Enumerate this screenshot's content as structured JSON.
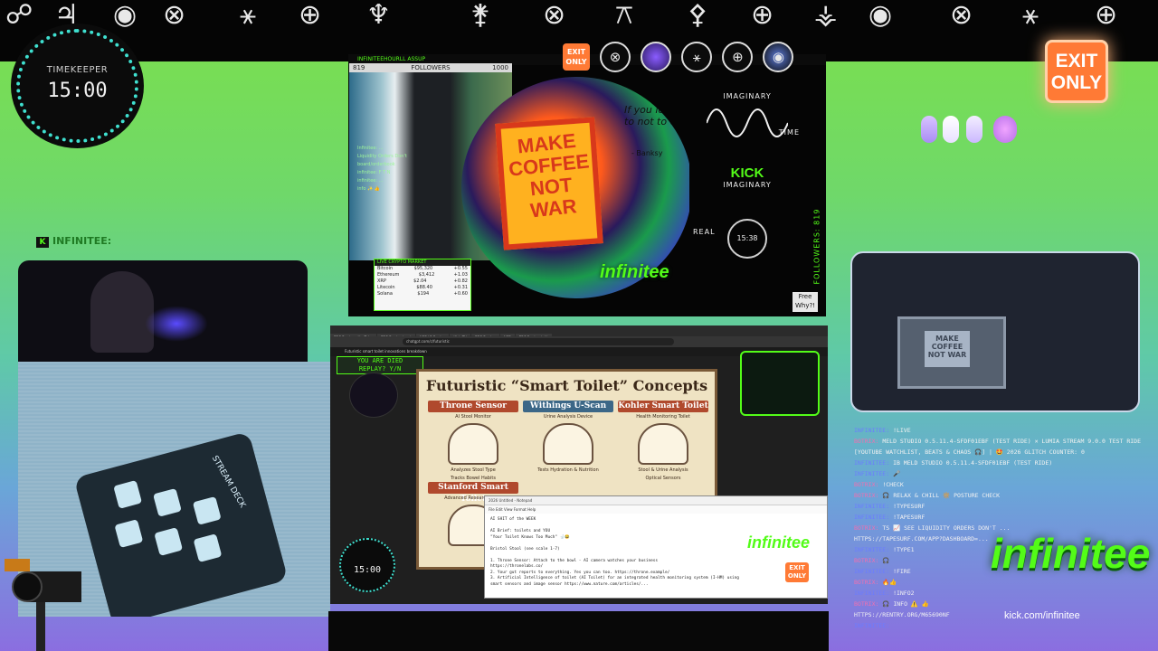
{
  "top_glyphs": [
    "☍",
    "♃",
    "◉",
    "⊗",
    "⚹",
    "⊕",
    "♆",
    "⚵",
    "⊗",
    "⚻",
    "⚴",
    "⊕",
    "⚶",
    "◉",
    "⊗",
    "⚹",
    "⊕"
  ],
  "timekeeper": {
    "label": "TIMEKEEPER",
    "time": "15:00"
  },
  "exit_sign": {
    "line1": "EXIT",
    "line2": "ONLY"
  },
  "nametag": {
    "platform": "K",
    "name": "INFINITEE:"
  },
  "center_top": {
    "header": "INFINITEEHOURLL ASSUP",
    "followers_label": "FOLLOWERS",
    "followers_count": "1000",
    "followers_current": "819",
    "exit_mini": {
      "line1": "EXIT",
      "line2": "ONLY"
    },
    "art_sign": "MAKE COFFEE NOT WAR",
    "art_quote": "If you learn to not to quit",
    "art_quote_author": "- Banksy",
    "wave_label_top": "IMAGINARY",
    "wave_label_time": "TIME",
    "kick_logo": "KICK",
    "wave_label_bottom": "IMAGINARY",
    "real_label": "REAL",
    "clock": "15:38",
    "vertical_followers": "FOLLOWERS: 819",
    "infinitee_logo": "infinitee",
    "free_why": "Free Why?!",
    "mini_chat": [
      "Infinitee: ...",
      "Liquidity Orders Don't",
      "board/orderbook",
      "infinitee: F T N",
      "infinitee: ...",
      "info ✨ 👍"
    ],
    "crypto": {
      "header": "LIVE CRYPTO MARKET",
      "rows": [
        {
          "name": "Bitcoin",
          "price": "$95,320",
          "chg": "+0.55"
        },
        {
          "name": "Ethereum",
          "price": "$3,412",
          "chg": "+1.03"
        },
        {
          "name": "XRP",
          "price": "$2.04",
          "chg": "+0.82"
        },
        {
          "name": "Litecoin",
          "price": "$88.40",
          "chg": "+0.31"
        },
        {
          "name": "Solana",
          "price": "$194",
          "chg": "+0.60"
        }
      ]
    }
  },
  "browser": {
    "tabs": [
      "ERC Replay - YouTube",
      "ERC Replay (sec)",
      "NSF LP Replay",
      "Kick.TV",
      "ERC Replay",
      "NSF",
      "ERC Replay (alt)"
    ],
    "address": "chatgpt.com/c/futuristic",
    "doc_title": "Futuristic smart toilet innovations breakdown",
    "died_line1": "YOU ARE DIED",
    "died_line2": "REPLAY? Y/N"
  },
  "concepts": {
    "title": "Futuristic “Smart Toilet” Concepts",
    "panels": [
      {
        "name": "Throne Sensor",
        "sub": "AI Stool Monitor",
        "features": [
          "Analyzes Stool Type",
          "Tracks Bowel Habits"
        ],
        "color": "#b0492d"
      },
      {
        "name": "Withings U-Scan",
        "sub": "Urine Analysis Device",
        "features": [
          "Tests Hydration & Nutrition"
        ],
        "color": "#3c6787"
      },
      {
        "name": "Kohler Smart Toilet",
        "sub": "Health Monitoring Toilet",
        "features": [
          "Stool & Urine Analysis",
          "Optical Sensors"
        ],
        "color": "#b0492d"
      },
      {
        "name": "Stanford Smart Toilet",
        "sub": "Advanced Research Proto",
        "features": [],
        "color": "#b0492d"
      }
    ]
  },
  "editor": {
    "tabbar": "2026 Untitled - Notepad",
    "menu": "File   Edit   View   Format   Help",
    "lines": [
      "AI SHIT of the WEEK",
      "",
      "AI Brief: toilets and YOU",
      "\"Your Toilet Knows Too Much\" 🚽😂",
      "",
      "Bristol Stool (see scale 1-7)",
      "",
      "1. Throne Sensor: Attach to the bowl - AI camera watches your business",
      "   https://thronelabs.co/",
      "2. Your gut reports to everything. Yes you can too. https://throne.example/",
      "3. Artificial Intelligence of toilet (AI Toilet) for an integrated health monitoring system (I-HM) using",
      "   smart sensors and image sensor https://www.nature.com/articles/..."
    ]
  },
  "tk_small": {
    "time": "15:00"
  },
  "infinitee_mid": "infinitee",
  "exit_mini2": {
    "line1": "EXIT",
    "line2": "ONLY"
  },
  "chat": [
    {
      "user": "INFINITEE:",
      "msg": "!LIVE"
    },
    {
      "user": "BOTRIX:",
      "msg": "MELD STUDIO 0.5.11.4-SFDF01EBF (TEST RIDE) ✕ LUMIA STREAM 9.0.0 TEST RIDE [YOUTUBE WATCHLIST, BEATS & CHAOS 🎧] | 🤩 2026 GLITCH COUNTER: 0"
    },
    {
      "user": "INFINITEE:",
      "msg": "IB MELD STUDIO 0.5.11.4-SFDF01EBF (TEST RIDE)"
    },
    {
      "user": "INFINITEE:",
      "msg": "🎤"
    },
    {
      "user": "BOTRIX:",
      "msg": "!CHECK"
    },
    {
      "user": "BOTRIX:",
      "msg": "🎧 RELAX & CHILL 🔆 POSTURE CHECK"
    },
    {
      "user": "INFINITEE:",
      "msg": "!TYPESURF"
    },
    {
      "user": "INFINITEE:",
      "msg": "!TAPESURF"
    },
    {
      "user": "BOTRIX:",
      "msg": "TS 📈 SEE LIQUIDITY ORDERS DON'T ..."
    },
    {
      "user": "",
      "msg": "HTTPS://TAPESURF.COM/APP?DASHBOARD=..."
    },
    {
      "user": "INFINITEE:",
      "msg": "!TYPE1"
    },
    {
      "user": "BOTRIX:",
      "msg": "🎧"
    },
    {
      "user": "INFINITEE:",
      "msg": "!FIRE"
    },
    {
      "user": "BOTRIX:",
      "msg": "🔥👍"
    },
    {
      "user": "INFINITEE:",
      "msg": "!INFO2"
    },
    {
      "user": "BOTRIX:",
      "msg": "🎧 INFO ⚠️ 👍"
    },
    {
      "user": "",
      "msg": "HTTPS://RENTRY.ORG/M65690NF"
    },
    {
      "user": "INFINITEE:",
      "msg": ""
    }
  ],
  "infinitee_big": "infinitee",
  "kick_url": "kick.com/infinitee",
  "webcam_right_poster": "MAKE COFFEE NOT WAR",
  "hand_feed_tag": "STREAM DECK"
}
